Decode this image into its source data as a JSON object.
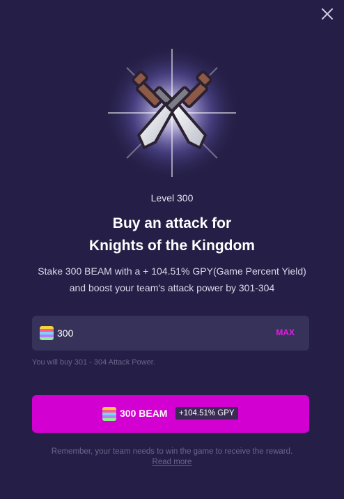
{
  "modal": {
    "close_icon": "close-icon",
    "hero_icon": "crossed-swords-icon",
    "level": "Level 300",
    "title_line1": "Buy an attack for",
    "title_line2": "Knights of the Kingdom",
    "desc_line1": "Stake 300 BEAM with a + 104.51% GPY(Game Percent Yield)",
    "desc_line2": "and boost your team's attack power by 301-304",
    "amount": {
      "value": "300",
      "token_icon": "beam-token-icon",
      "max_label": "MAX"
    },
    "hint": "You will buy 301 - 304 Attack Power.",
    "buy_button": {
      "label": "300 BEAM",
      "badge": "+104.51% GPY"
    },
    "footer_text": "Remember, your team needs to win the game to receive the reward.",
    "read_more": "Read more"
  },
  "colors": {
    "background": "#251f47",
    "accent": "#d200d0",
    "max": "#e21ce0",
    "input_bg": "#373259"
  }
}
